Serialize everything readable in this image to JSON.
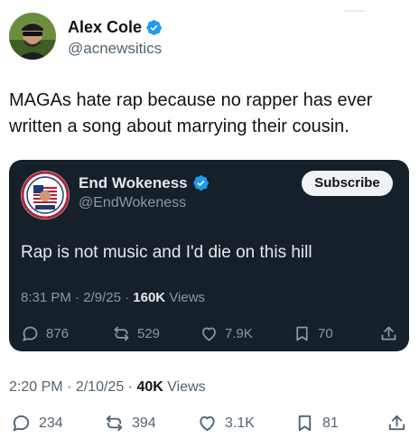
{
  "tweet": {
    "author": {
      "name": "Alex Cole",
      "handle": "@acnewsitics"
    },
    "text": "MAGAs hate rap because no rapper has ever written a song about marrying their cousin.",
    "meta": {
      "time": "2:20 PM",
      "date": "2/10/25",
      "views_count": "40K",
      "views_label": "Views"
    },
    "actions": {
      "replies": "234",
      "reposts": "394",
      "likes": "3.1K",
      "bookmarks": "81"
    }
  },
  "quoted": {
    "author": {
      "name": "End Wokeness",
      "handle": "@EndWokeness"
    },
    "subscribe_label": "Subscribe",
    "text": "Rap is not music and I'd die on this hill",
    "meta": {
      "time": "8:31 PM",
      "date": "2/9/25",
      "views_count": "160K",
      "views_label": "Views"
    },
    "actions": {
      "replies": "876",
      "reposts": "529",
      "likes": "7.9K",
      "bookmarks": "70"
    }
  },
  "colors": {
    "verified": "#1d9bf0",
    "card_bg": "#15202b",
    "secondary_text": "#536471"
  }
}
